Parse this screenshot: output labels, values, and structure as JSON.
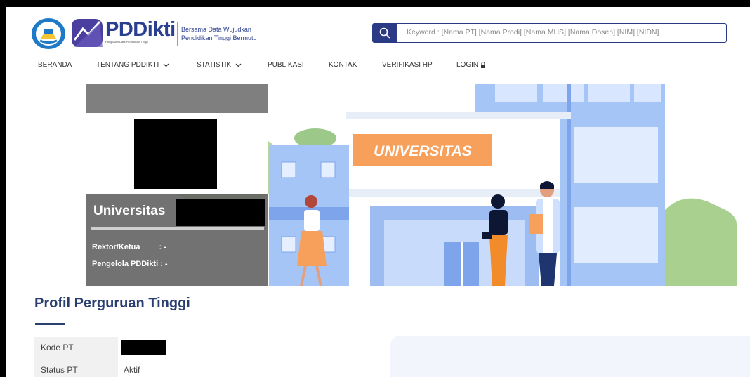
{
  "header": {
    "brand_name": "PDDikti",
    "brand_sub": "Pangkalan Data Pendidikan Tinggi",
    "tagline_line1": "Bersama Data Wujudkan",
    "tagline_line2": "Pendidikan Tinggi Bermutu"
  },
  "search": {
    "placeholder": "Keyword : [Nama PT] [Nama Prodi] [Nama MHS] [Nama Dosen] [NIM] [NIDN]."
  },
  "nav": {
    "beranda": "BERANDA",
    "tentang": "TENTANG PDDIKTI",
    "statistik": "STATISTIK",
    "publikasi": "PUBLIKASI",
    "kontak": "KONTAK",
    "verifikasi": "VERIFIKASI HP",
    "login": "LOGIN"
  },
  "banner": {
    "sign": "UNIVERSITAS"
  },
  "profile_card": {
    "uni_prefix": "Universitas",
    "rector_label": "Rektor/Ketua",
    "rector_value": ": -",
    "manager_label": "Pengelola PDDikti",
    "manager_value": ": -"
  },
  "content": {
    "title": "Profil Perguruan Tinggi",
    "rows": [
      {
        "label": "Kode PT",
        "value": ""
      },
      {
        "label": "Status PT",
        "value": "Aktif"
      }
    ]
  },
  "colors": {
    "primary": "#2a3f90",
    "accent": "#f28b2a",
    "sign": "#f6a05c"
  },
  "icons": {
    "search": "search-icon",
    "chevron": "chevron-down-icon",
    "lock": "lock-icon"
  }
}
